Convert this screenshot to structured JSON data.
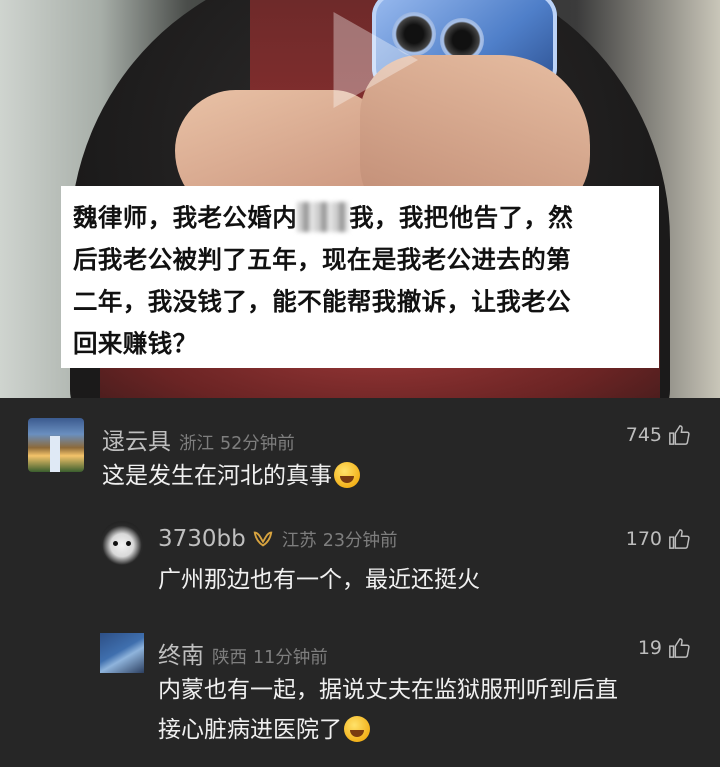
{
  "video": {
    "caption_lines": [
      "魏律师，我老公婚内",
      "我，我把他告了，然",
      "后我老公被判了五年，现在是我老公进去的第",
      "二年，我没钱了，能不能帮我撤诉，让我老公",
      "回来赚钱？"
    ]
  },
  "comments": [
    {
      "user": "逯云具",
      "location": "浙江",
      "time": "52分钟前",
      "likes": "745",
      "text": "这是发生在河北的真事"
    },
    {
      "user": "3730bb",
      "location": "江苏",
      "time": "23分钟前",
      "likes": "170",
      "text": "广州那边也有一个，最近还挺火"
    },
    {
      "user": "终南",
      "location": "陕西",
      "time": "11分钟前",
      "likes": "19",
      "text_lines": [
        "内蒙也有一起，据说丈夫在监狱服刑听到后直",
        "接心脏病进医院了"
      ]
    }
  ],
  "icons": {
    "like": "thumbs-up-icon",
    "emoji": "laughing-crying-emoji-icon",
    "play": "play-icon",
    "badge": "ribbon-badge-icon"
  }
}
